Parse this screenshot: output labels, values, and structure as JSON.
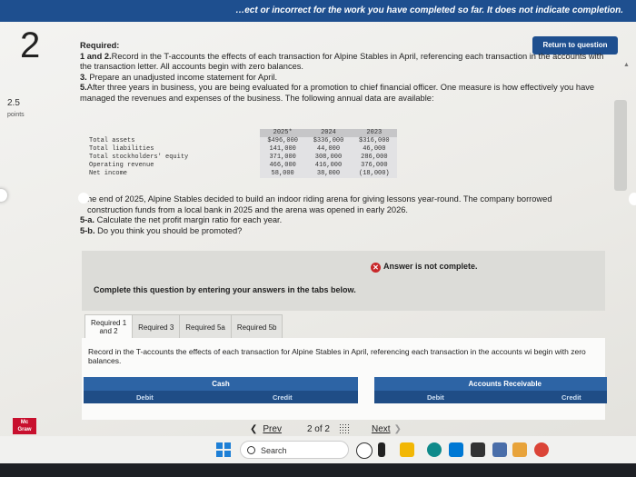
{
  "header": {
    "banner_text": "…ect or incorrect for the work you have completed so far. It does not indicate completion."
  },
  "question": {
    "number": "2",
    "points_value": "2.5",
    "points_label": "points"
  },
  "return_button": "Return to question",
  "instructions": {
    "heading": "Required:",
    "line1_bold": "1 and 2.",
    "line1_text": "Record in the T-accounts the effects of each transaction for Alpine Stables in April, referencing each transaction in the accounts with the transaction letter. All accounts begin with zero balances.",
    "line2_bold": "3.",
    "line2_text": " Prepare an unadjusted income statement for April.",
    "line3_bold": "5.",
    "line3_text": "After three years in business, you are being evaluated for a promotion to chief financial officer. One measure is how effectively you have managed the revenues and expenses of the business. The following annual data are available:"
  },
  "data_table": {
    "headers": [
      "2025*",
      "2024",
      "2023"
    ],
    "rows": [
      {
        "label": "Total assets",
        "values": [
          "$496,000",
          "$336,000",
          "$316,000"
        ]
      },
      {
        "label": "Total liabilities",
        "values": [
          "141,000",
          "44,000",
          "46,000"
        ]
      },
      {
        "label": "Total stockholders' equity",
        "values": [
          "371,000",
          "308,000",
          "286,000"
        ]
      },
      {
        "label": "Operating revenue",
        "values": [
          "466,000",
          "416,000",
          "376,000"
        ]
      },
      {
        "label": "Net income",
        "values": [
          "58,000",
          "38,000",
          "(18,000)"
        ]
      }
    ]
  },
  "paragraph": {
    "line1": "he end of 2025, Alpine Stables decided to build an indoor riding arena for giving lessons year-round. The company borrowed construction funds from a local bank in 2025 and the arena was opened in early 2026.",
    "q5a_bold": "5-a.",
    "q5a_text": " Calculate the net profit margin ratio for each year.",
    "q5b_bold": "5-b.",
    "q5b_text": " Do you think you should be promoted?"
  },
  "status": {
    "text": "Answer is not complete.",
    "icon": "x-circle-icon",
    "color": "#c8282a"
  },
  "complete_prompt": "Complete this question by entering your answers in the tabs below.",
  "tabs": [
    {
      "line1": "Required 1",
      "line2": "and 2"
    },
    {
      "label": "Required 3"
    },
    {
      "label": "Required 5a"
    },
    {
      "label": "Required 5b"
    }
  ],
  "tab_content": {
    "record_text": "Record in the T-accounts the effects of each transaction for Alpine Stables in April, referencing each transaction in the accounts wi begin with zero balances."
  },
  "t_accounts": [
    {
      "name": "Cash",
      "debit": "Debit",
      "credit": "Credit"
    },
    {
      "name": "Accounts Receivable",
      "debit": "Debit",
      "credit": "Credit"
    }
  ],
  "pagination": {
    "prev": "Prev",
    "page": "2",
    "of": "of",
    "total": "2",
    "next": "Next"
  },
  "brand": {
    "line1": "Mc",
    "line2": "Graw"
  },
  "taskbar": {
    "search_label": "Search"
  },
  "colors": {
    "accent": "#1e4f8f",
    "t_account_header": "#2d64a5",
    "brand_red": "#c8102e"
  }
}
